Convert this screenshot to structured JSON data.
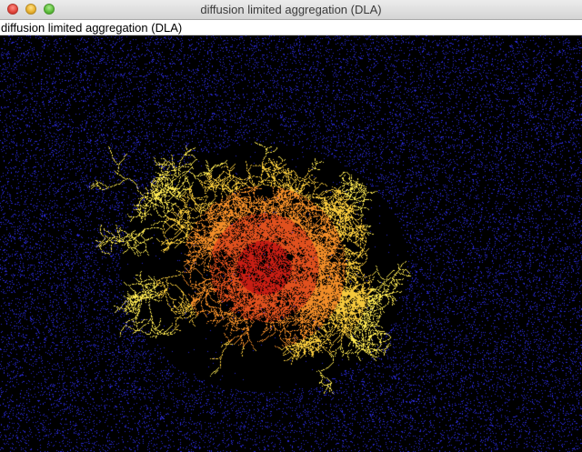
{
  "window": {
    "title": "diffusion limited aggregation (DLA)"
  },
  "panel": {
    "label": "diffusion limited aggregation (DLA)"
  },
  "simulation": {
    "background_color": "#000000",
    "particle_color": "#2a2ad6",
    "cluster_colors": [
      "#c81e14",
      "#e0501e",
      "#f08c28",
      "#f5c83c",
      "#fae650"
    ]
  }
}
